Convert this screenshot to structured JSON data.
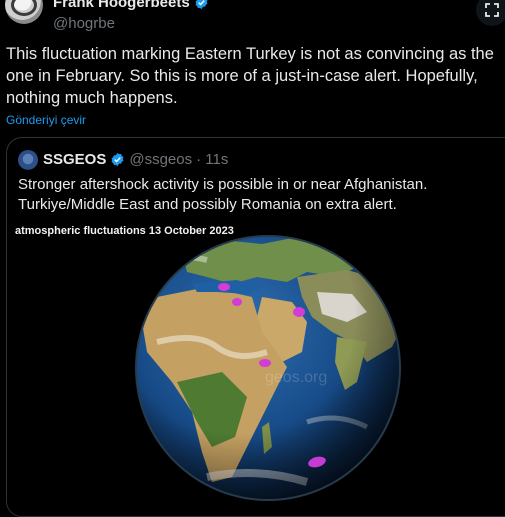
{
  "author": {
    "name": "Frank Hoogerbeets",
    "handle": "@hogrbe"
  },
  "tweet": {
    "text": "This fluctuation marking Eastern Turkey is not as convincing as the one in February. So this is more of a just-in-case alert. Hopefully, nothing much happens.",
    "translate_label": "Gönderiyi çevir"
  },
  "quote": {
    "name": "SSGEOS",
    "handle": "@ssgeos",
    "time": "· 11s",
    "text": "Stronger aftershock activity is possible in or near Afghanistan. Turkiye/Middle East and possibly Romania on extra alert.",
    "media_title": "atmospheric fluctuations 13 October 2023",
    "watermark": "geos.org"
  },
  "icons": {
    "verified": "verified-badge-icon",
    "expand": "expand-icon"
  },
  "colors": {
    "accent": "#1d9bf0",
    "marker": "#d43cd6"
  }
}
